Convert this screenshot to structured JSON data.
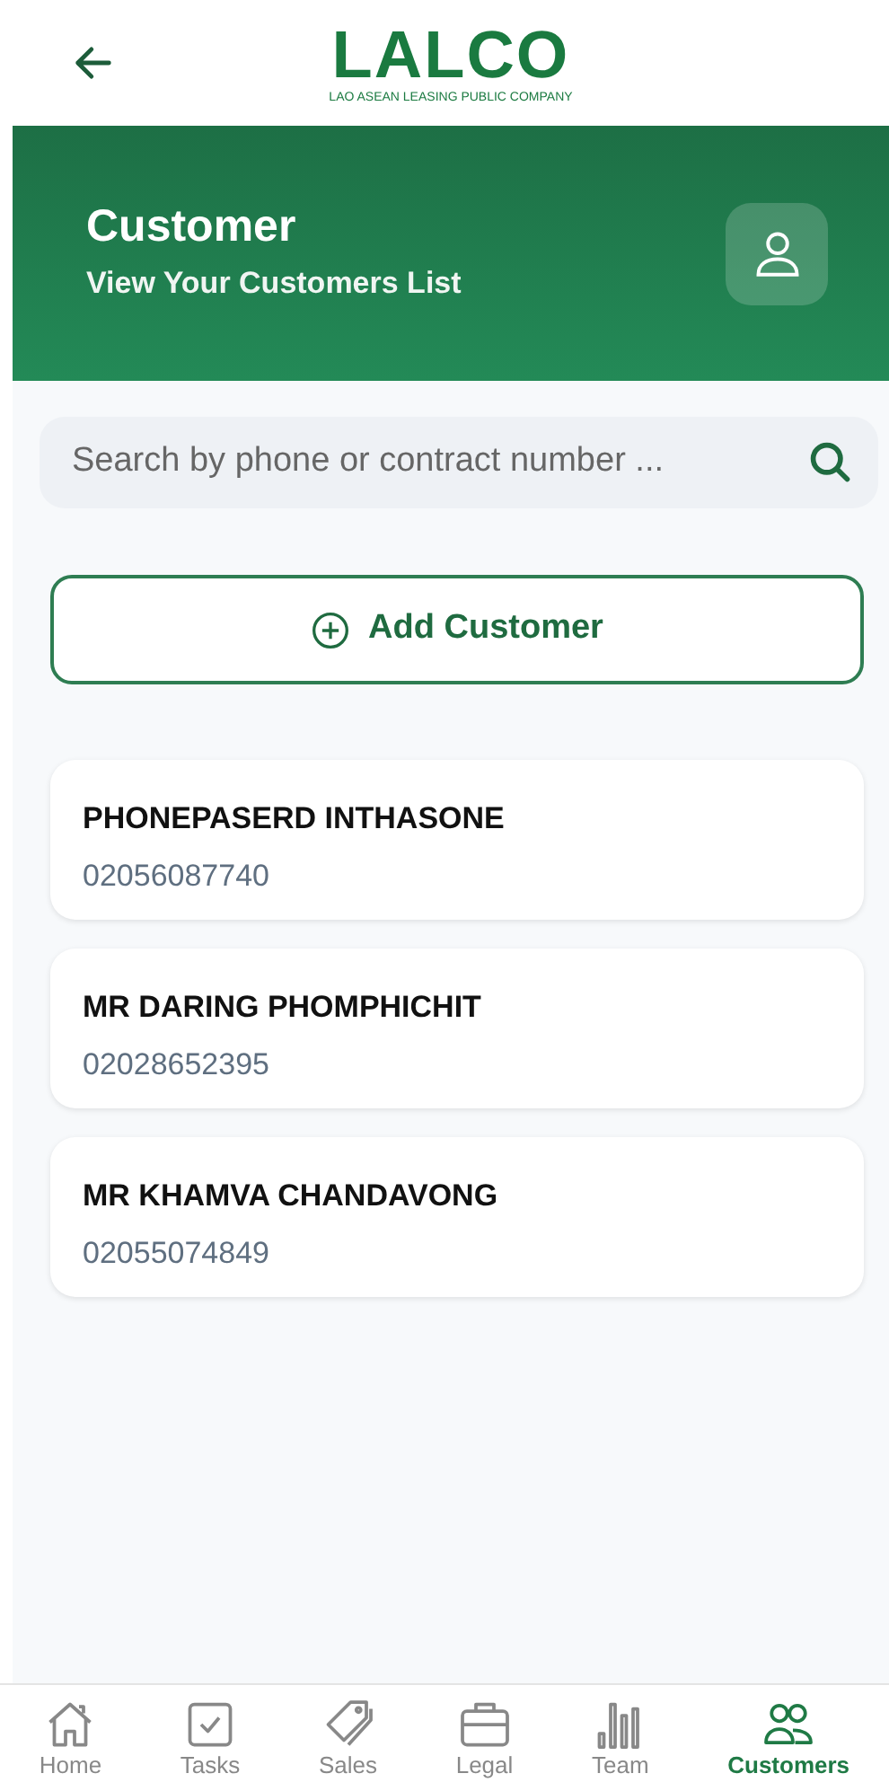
{
  "logo": {
    "name": "LALCO",
    "tagline": "LAO ASEAN LEASING PUBLIC COMPANY"
  },
  "banner": {
    "title": "Customer",
    "subtitle": "View Your Customers List"
  },
  "search": {
    "placeholder": "Search by phone or contract number ..."
  },
  "add_button": "Add Customer",
  "customers": [
    {
      "name": "PHONEPASERD INTHASONE",
      "phone": "02056087740"
    },
    {
      "name": "MR DARING PHOMPHICHIT",
      "phone": "02028652395"
    },
    {
      "name": "MR KHAMVA CHANDAVONG",
      "phone": "02055074849"
    }
  ],
  "nav": [
    {
      "label": "Home",
      "kind": "home",
      "selected": false
    },
    {
      "label": "Tasks",
      "kind": "tasks",
      "selected": false
    },
    {
      "label": "Sales",
      "kind": "sales",
      "selected": false
    },
    {
      "label": "Legal",
      "kind": "legal",
      "selected": false
    },
    {
      "label": "Team",
      "kind": "team",
      "selected": false
    },
    {
      "label": "Customers",
      "kind": "customers",
      "selected": true
    }
  ]
}
